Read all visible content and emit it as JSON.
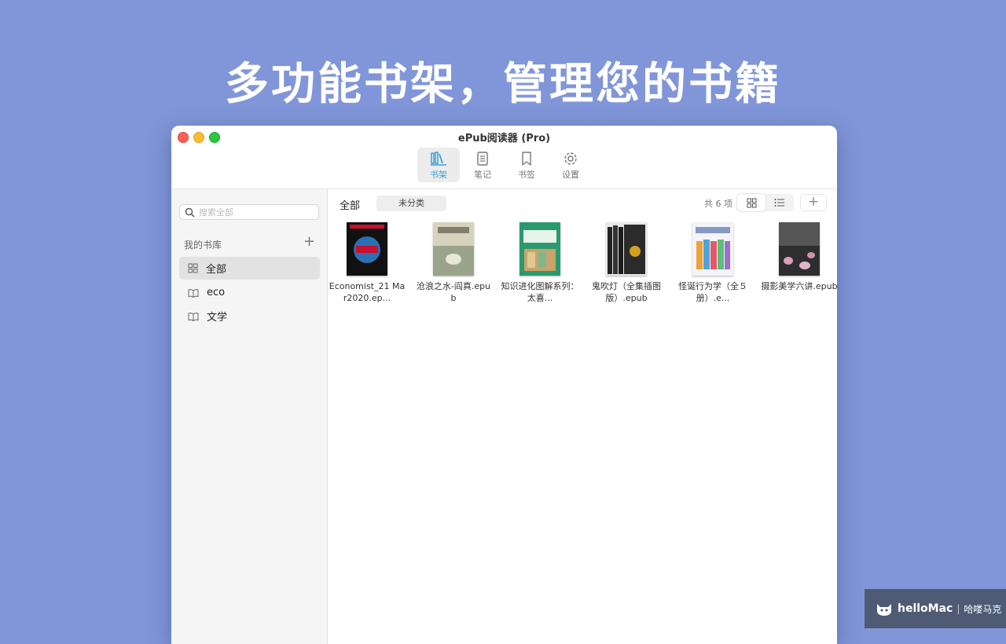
{
  "headline": "多功能书架，管理您的书籍",
  "window": {
    "title": "ePub阅读器 (Pro)"
  },
  "toolbar": {
    "items": [
      {
        "label": "书架",
        "icon": "bookshelf-icon",
        "active": true
      },
      {
        "label": "笔记",
        "icon": "notes-icon",
        "active": false
      },
      {
        "label": "书签",
        "icon": "bookmark-icon",
        "active": false
      },
      {
        "label": "设置",
        "icon": "gear-icon",
        "active": false
      }
    ]
  },
  "sidebar": {
    "search_placeholder": "搜索全部",
    "library_title": "我的书库",
    "add_label": "+",
    "items": [
      {
        "label": "全部",
        "icon": "grid-icon",
        "selected": true
      },
      {
        "label": "eco",
        "icon": "book-icon",
        "selected": false
      },
      {
        "label": "文学",
        "icon": "book-icon",
        "selected": false
      }
    ]
  },
  "main": {
    "filter_all": "全部",
    "filter_uncategorized": "未分类",
    "count_text": "共 6 项",
    "add_label": "+",
    "books": [
      {
        "title": "Economist_21 Mar2020.ep...",
        "cover_color": "#111111"
      },
      {
        "title": "沧浪之水-阎真.epub",
        "cover_color": "#c9c8b0"
      },
      {
        "title": "知识进化图解系列：太喜...",
        "cover_color": "#2a9a6e"
      },
      {
        "title": "鬼吹灯（全集插图版）.epub",
        "cover_color": "#2b2b2b"
      },
      {
        "title": "怪诞行为学（全５册）.e...",
        "cover_color": "#f0a23a"
      },
      {
        "title": "摄影美学六讲.epub",
        "cover_color": "#3a3a3a"
      }
    ]
  },
  "watermark": {
    "brand": "helloMac",
    "cn": "哈喽马克"
  }
}
